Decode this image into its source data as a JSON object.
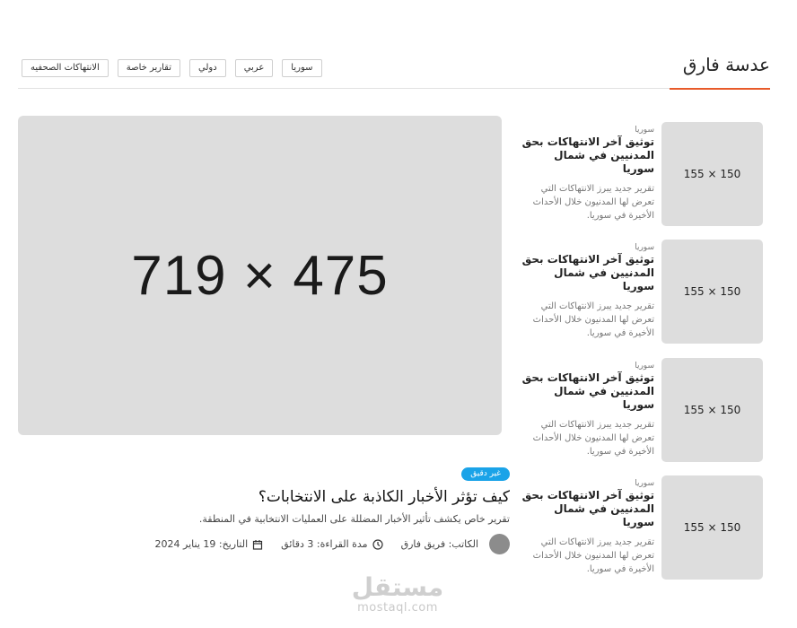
{
  "section": {
    "title": "عدسة فارق"
  },
  "tags": [
    "سوريا",
    "عربي",
    "دولي",
    "تقارير خاصة",
    "الانتهاكات الصحفيه"
  ],
  "hero": {
    "placeholder": "719 × 475"
  },
  "featured": {
    "badge": "غير دقيق",
    "title": "كيف تؤثر الأخبار الكاذبة على الانتخابات؟",
    "description": "تقرير خاص يكشف تأثير الأخبار المضللة على العمليات الانتخابية في المنطقة.",
    "author": "الكاتب: فريق فارق",
    "read_time": "مدة القراءة: 3 دقائق",
    "date": "التاريخ: 19 يناير 2024"
  },
  "side_articles": [
    {
      "thumb": "150 × 155",
      "category": "سوريا",
      "title": "توثيق آخر الانتهاكات بحق المدنيين في شمال سوريا",
      "description": "تقرير جديد يبرز الانتهاكات التي تعرض لها المدنيون خلال الأحداث الأخيرة في سوريا."
    },
    {
      "thumb": "150 × 155",
      "category": "سوريا",
      "title": "توثيق آخر الانتهاكات بحق المدنيين في شمال سوريا",
      "description": "تقرير جديد يبرز الانتهاكات التي تعرض لها المدنيون خلال الأحداث الأخيرة في سوريا."
    },
    {
      "thumb": "150 × 155",
      "category": "سوريا",
      "title": "توثيق آخر الانتهاكات بحق المدنيين في شمال سوريا",
      "description": "تقرير جديد يبرز الانتهاكات التي تعرض لها المدنيون خلال الأحداث الأخيرة في سوريا."
    },
    {
      "thumb": "150 × 155",
      "category": "سوريا",
      "title": "توثيق آخر الانتهاكات بحق المدنيين في شمال سوريا",
      "description": "تقرير جديد يبرز الانتهاكات التي تعرض لها المدنيون خلال الأحداث الأخيرة في سوريا."
    }
  ],
  "watermark": {
    "logo": "مستقل",
    "url": "mostaql.com"
  },
  "colors": {
    "accent": "#e85a2a",
    "badge": "#1aa3e8",
    "placeholder": "#dddddd"
  }
}
